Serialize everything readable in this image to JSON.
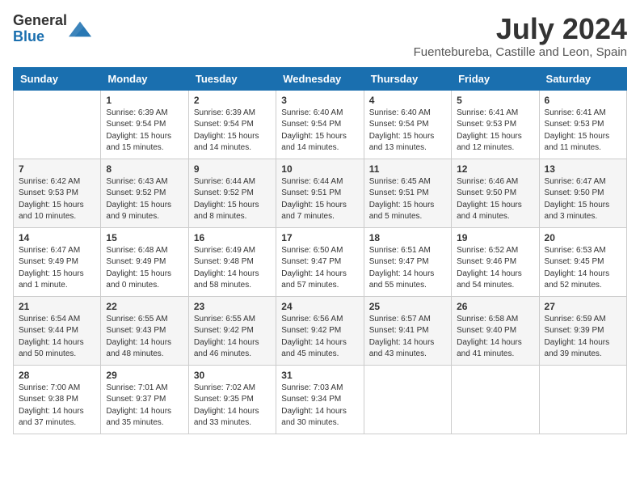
{
  "logo": {
    "general": "General",
    "blue": "Blue"
  },
  "title": {
    "month_year": "July 2024",
    "location": "Fuentebureba, Castille and Leon, Spain"
  },
  "weekdays": [
    "Sunday",
    "Monday",
    "Tuesday",
    "Wednesday",
    "Thursday",
    "Friday",
    "Saturday"
  ],
  "weeks": [
    [
      {
        "day": null,
        "info": null
      },
      {
        "day": "1",
        "sunrise": "Sunrise: 6:39 AM",
        "sunset": "Sunset: 9:54 PM",
        "daylight": "Daylight: 15 hours and 15 minutes."
      },
      {
        "day": "2",
        "sunrise": "Sunrise: 6:39 AM",
        "sunset": "Sunset: 9:54 PM",
        "daylight": "Daylight: 15 hours and 14 minutes."
      },
      {
        "day": "3",
        "sunrise": "Sunrise: 6:40 AM",
        "sunset": "Sunset: 9:54 PM",
        "daylight": "Daylight: 15 hours and 14 minutes."
      },
      {
        "day": "4",
        "sunrise": "Sunrise: 6:40 AM",
        "sunset": "Sunset: 9:54 PM",
        "daylight": "Daylight: 15 hours and 13 minutes."
      },
      {
        "day": "5",
        "sunrise": "Sunrise: 6:41 AM",
        "sunset": "Sunset: 9:53 PM",
        "daylight": "Daylight: 15 hours and 12 minutes."
      },
      {
        "day": "6",
        "sunrise": "Sunrise: 6:41 AM",
        "sunset": "Sunset: 9:53 PM",
        "daylight": "Daylight: 15 hours and 11 minutes."
      }
    ],
    [
      {
        "day": "7",
        "sunrise": "Sunrise: 6:42 AM",
        "sunset": "Sunset: 9:53 PM",
        "daylight": "Daylight: 15 hours and 10 minutes."
      },
      {
        "day": "8",
        "sunrise": "Sunrise: 6:43 AM",
        "sunset": "Sunset: 9:52 PM",
        "daylight": "Daylight: 15 hours and 9 minutes."
      },
      {
        "day": "9",
        "sunrise": "Sunrise: 6:44 AM",
        "sunset": "Sunset: 9:52 PM",
        "daylight": "Daylight: 15 hours and 8 minutes."
      },
      {
        "day": "10",
        "sunrise": "Sunrise: 6:44 AM",
        "sunset": "Sunset: 9:51 PM",
        "daylight": "Daylight: 15 hours and 7 minutes."
      },
      {
        "day": "11",
        "sunrise": "Sunrise: 6:45 AM",
        "sunset": "Sunset: 9:51 PM",
        "daylight": "Daylight: 15 hours and 5 minutes."
      },
      {
        "day": "12",
        "sunrise": "Sunrise: 6:46 AM",
        "sunset": "Sunset: 9:50 PM",
        "daylight": "Daylight: 15 hours and 4 minutes."
      },
      {
        "day": "13",
        "sunrise": "Sunrise: 6:47 AM",
        "sunset": "Sunset: 9:50 PM",
        "daylight": "Daylight: 15 hours and 3 minutes."
      }
    ],
    [
      {
        "day": "14",
        "sunrise": "Sunrise: 6:47 AM",
        "sunset": "Sunset: 9:49 PM",
        "daylight": "Daylight: 15 hours and 1 minute."
      },
      {
        "day": "15",
        "sunrise": "Sunrise: 6:48 AM",
        "sunset": "Sunset: 9:49 PM",
        "daylight": "Daylight: 15 hours and 0 minutes."
      },
      {
        "day": "16",
        "sunrise": "Sunrise: 6:49 AM",
        "sunset": "Sunset: 9:48 PM",
        "daylight": "Daylight: 14 hours and 58 minutes."
      },
      {
        "day": "17",
        "sunrise": "Sunrise: 6:50 AM",
        "sunset": "Sunset: 9:47 PM",
        "daylight": "Daylight: 14 hours and 57 minutes."
      },
      {
        "day": "18",
        "sunrise": "Sunrise: 6:51 AM",
        "sunset": "Sunset: 9:47 PM",
        "daylight": "Daylight: 14 hours and 55 minutes."
      },
      {
        "day": "19",
        "sunrise": "Sunrise: 6:52 AM",
        "sunset": "Sunset: 9:46 PM",
        "daylight": "Daylight: 14 hours and 54 minutes."
      },
      {
        "day": "20",
        "sunrise": "Sunrise: 6:53 AM",
        "sunset": "Sunset: 9:45 PM",
        "daylight": "Daylight: 14 hours and 52 minutes."
      }
    ],
    [
      {
        "day": "21",
        "sunrise": "Sunrise: 6:54 AM",
        "sunset": "Sunset: 9:44 PM",
        "daylight": "Daylight: 14 hours and 50 minutes."
      },
      {
        "day": "22",
        "sunrise": "Sunrise: 6:55 AM",
        "sunset": "Sunset: 9:43 PM",
        "daylight": "Daylight: 14 hours and 48 minutes."
      },
      {
        "day": "23",
        "sunrise": "Sunrise: 6:55 AM",
        "sunset": "Sunset: 9:42 PM",
        "daylight": "Daylight: 14 hours and 46 minutes."
      },
      {
        "day": "24",
        "sunrise": "Sunrise: 6:56 AM",
        "sunset": "Sunset: 9:42 PM",
        "daylight": "Daylight: 14 hours and 45 minutes."
      },
      {
        "day": "25",
        "sunrise": "Sunrise: 6:57 AM",
        "sunset": "Sunset: 9:41 PM",
        "daylight": "Daylight: 14 hours and 43 minutes."
      },
      {
        "day": "26",
        "sunrise": "Sunrise: 6:58 AM",
        "sunset": "Sunset: 9:40 PM",
        "daylight": "Daylight: 14 hours and 41 minutes."
      },
      {
        "day": "27",
        "sunrise": "Sunrise: 6:59 AM",
        "sunset": "Sunset: 9:39 PM",
        "daylight": "Daylight: 14 hours and 39 minutes."
      }
    ],
    [
      {
        "day": "28",
        "sunrise": "Sunrise: 7:00 AM",
        "sunset": "Sunset: 9:38 PM",
        "daylight": "Daylight: 14 hours and 37 minutes."
      },
      {
        "day": "29",
        "sunrise": "Sunrise: 7:01 AM",
        "sunset": "Sunset: 9:37 PM",
        "daylight": "Daylight: 14 hours and 35 minutes."
      },
      {
        "day": "30",
        "sunrise": "Sunrise: 7:02 AM",
        "sunset": "Sunset: 9:35 PM",
        "daylight": "Daylight: 14 hours and 33 minutes."
      },
      {
        "day": "31",
        "sunrise": "Sunrise: 7:03 AM",
        "sunset": "Sunset: 9:34 PM",
        "daylight": "Daylight: 14 hours and 30 minutes."
      },
      {
        "day": null,
        "info": null
      },
      {
        "day": null,
        "info": null
      },
      {
        "day": null,
        "info": null
      }
    ]
  ]
}
